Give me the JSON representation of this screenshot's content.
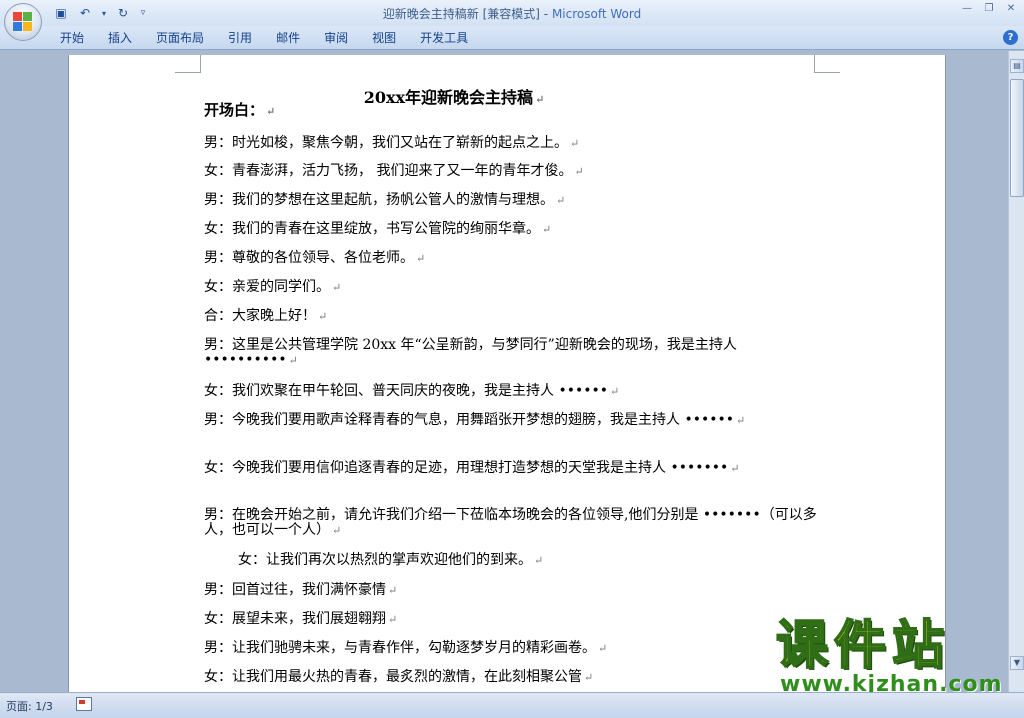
{
  "window": {
    "doc_name": "迎新晚会主持稿新",
    "mode": "[兼容模式]",
    "separator": " - ",
    "app_name": "Microsoft Word"
  },
  "ribbon": {
    "tabs": [
      "开始",
      "插入",
      "页面布局",
      "引用",
      "邮件",
      "审阅",
      "视图",
      "开发工具"
    ]
  },
  "document": {
    "title": "20xx年迎新晚会主持稿",
    "paragraph_mark": "↵",
    "lines": [
      "开场白：",
      "男：时光如梭，聚焦今朝，我们又站在了崭新的起点之上。",
      "女：青春澎湃，活力飞扬， 我们迎来了又一年的青年才俊。",
      "男：我们的梦想在这里起航，扬帆公管人的激情与理想。",
      "女：我们的青春在这里绽放，书写公管院的绚丽华章。",
      "男：尊敬的各位领导、各位老师。",
      "女：亲爱的同学们。",
      "合：大家晚上好！",
      "男：这里是公共管理学院 20xx 年“公呈新韵，与梦同行”迎新晚会的现场，我是主持人 ••••••••••",
      "女：我们欢聚在甲午轮回、普天同庆的夜晚，我是主持人 ••••••",
      "男：今晚我们要用歌声诠释青春的气息，用舞蹈张开梦想的翅膀，我是主持人 ••••••",
      "女：今晚我们要用信仰追逐青春的足迹，用理想打造梦想的天堂我是主持人 •••••••",
      "男：在晚会开始之前，请允许我们介绍一下莅临本场晚会的各位领导,他们分别是 •••••••（可以多人，也可以一个人）",
      "女：让我们再次以热烈的掌声欢迎他们的到来。",
      "男：回首过往，我们满怀豪情",
      "女：展望未来，我们展翅翱翔",
      "男：让我们驰骋未来，与青春作伴，勾勒逐梦岁月的精彩画卷。",
      "女：让我们用最火热的青春，最炙烈的激情，在此刻相聚公管"
    ]
  },
  "watermark": {
    "cn": "课件站",
    "url": "www.kjzhan.com"
  },
  "status": {
    "page_info": "页面: 1/3"
  },
  "colors": {
    "chrome_bg": "#a9b9cf",
    "ribbon": "#c6d8ef",
    "accent": "#15428b"
  }
}
